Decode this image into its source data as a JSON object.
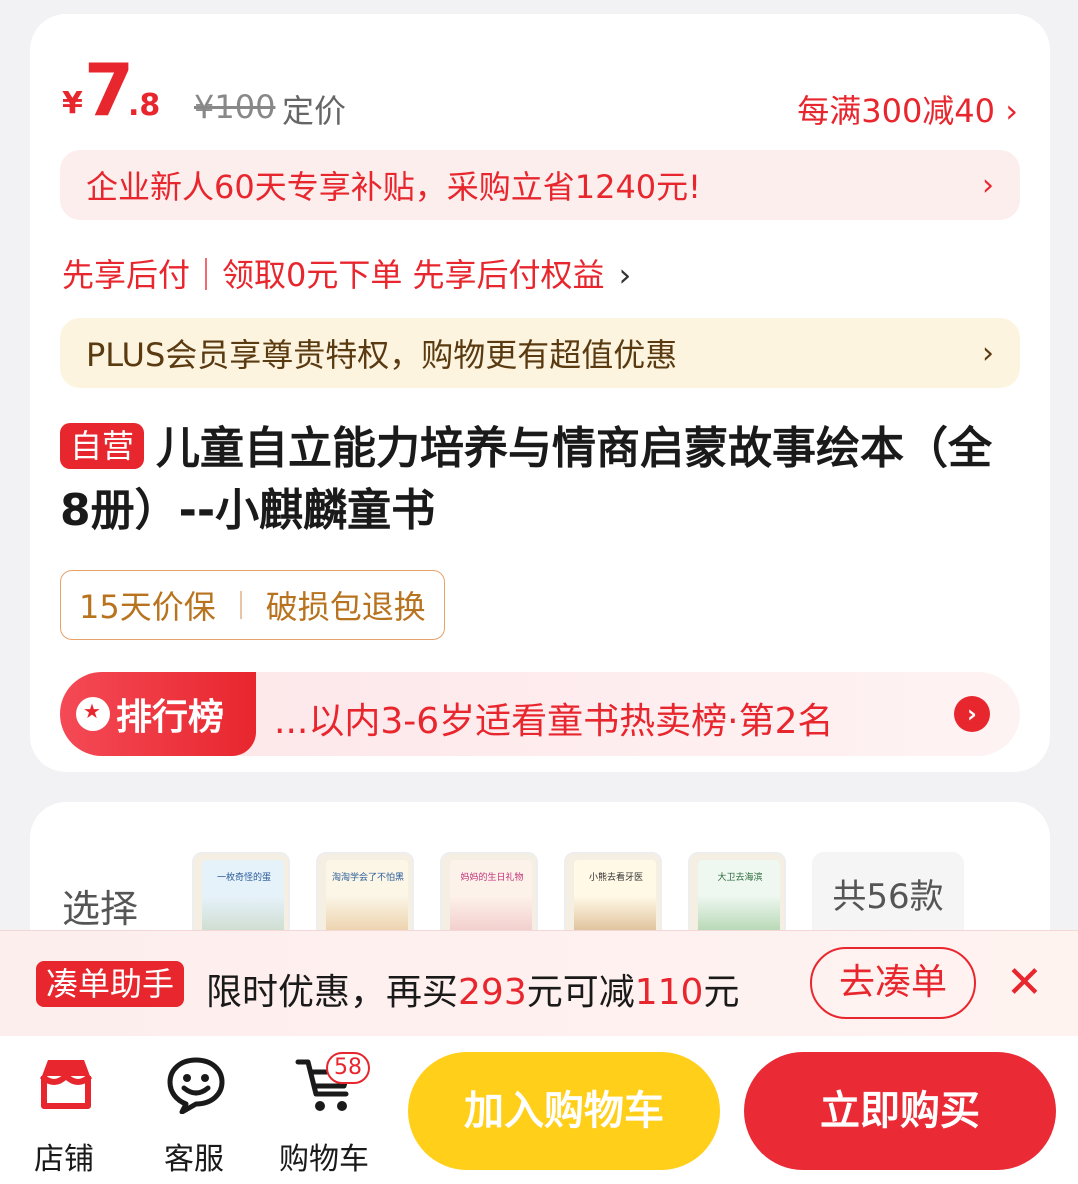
{
  "price": {
    "currency": "¥",
    "integer": "7",
    "decimal": ".8",
    "original": "¥100",
    "original_label": "定价",
    "promo": "每满300减40"
  },
  "banners": {
    "subsidy": "企业新人60天专享补贴，采购立省1240元!",
    "bnpl": "先享后付｜领取0元下单 先享后付权益",
    "plus": "PLUS会员享尊贵特权，购物更有超值优惠",
    "chevron": "›"
  },
  "product": {
    "self_tag": "自营",
    "title": "儿童自立能力培养与情商启蒙故事绘本（全8册）--小麒麟童书"
  },
  "service": {
    "price_protect": "15天价保",
    "damage_return": "破损包退换"
  },
  "ranking": {
    "badge_label": "排行榜",
    "text": "...以内3-6岁适看童书热卖榜·第2名"
  },
  "variants": {
    "label": "选择",
    "thumbs": [
      "一枚奇怪的蛋",
      "淘淘学会了不怕黑",
      "妈妈的生日礼物",
      "小熊去看牙医",
      "大卫去海滨"
    ],
    "count": "共56款"
  },
  "helper": {
    "tag": "凑单助手",
    "text_prefix": "限时优惠，再买",
    "amount": "293",
    "text_mid": "元可减",
    "discount": "110",
    "text_suffix": "元",
    "button": "去凑单",
    "close": "✕"
  },
  "bottom_bar": {
    "store": "店铺",
    "service": "客服",
    "cart": "购物车",
    "cart_count": "58",
    "add_to_cart": "加入购物车",
    "buy_now": "立即购买"
  },
  "colors": {
    "accent_red": "#e8262e",
    "gold": "#ffcf1a"
  }
}
